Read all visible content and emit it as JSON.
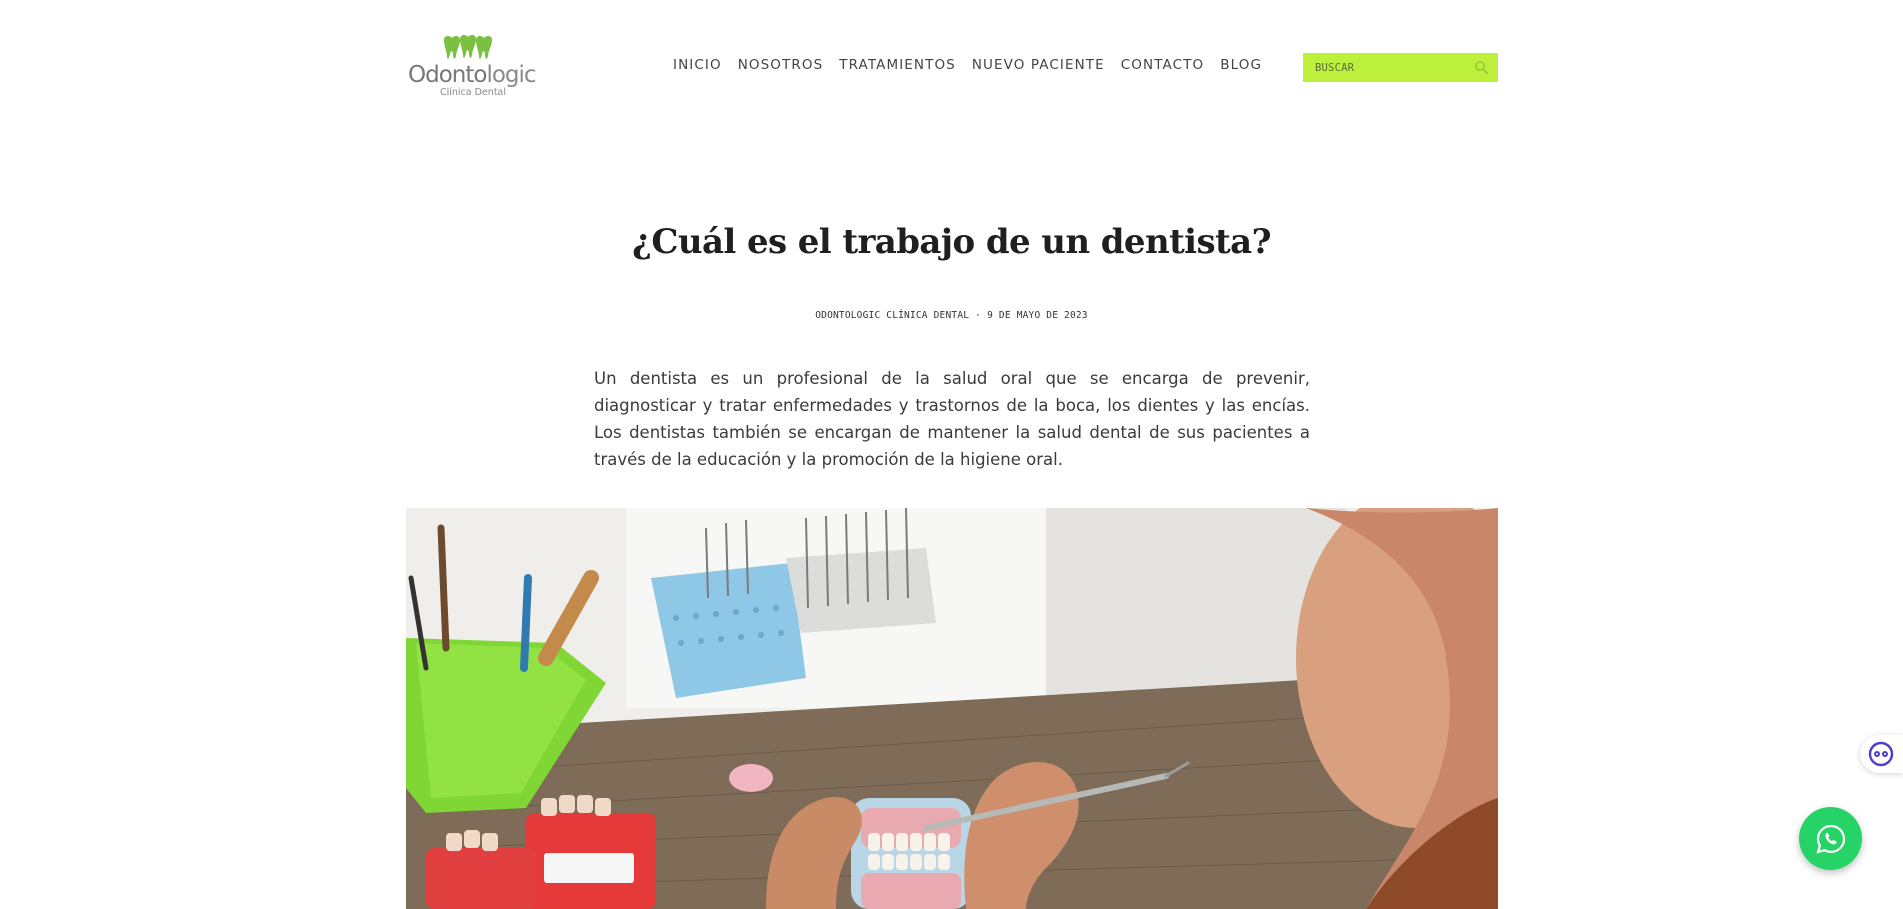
{
  "brand": {
    "name_part1": "Odonto",
    "name_part2": "logic",
    "tagline": "Clínica Dental",
    "accent_color": "#bdf03a",
    "logo_green": "#7ac142"
  },
  "nav": {
    "items": [
      "INICIO",
      "NOSOTROS",
      "TRATAMIENTOS",
      "NUEVO PACIENTE",
      "CONTACTO",
      "BLOG"
    ]
  },
  "search": {
    "placeholder": "BUSCAR",
    "icon": "search-icon"
  },
  "article": {
    "title": "¿Cuál es el trabajo de un dentista?",
    "author": "ODONTOLOGIC CLÍNICA DENTAL",
    "separator": "·",
    "date": "9 DE MAYO DE 2023",
    "intro": "Un dentista es un profesional de la salud oral que se encarga de prevenir, diagnosticar y tratar enfermedades y trastornos de la boca, los dientes y las encías. Los dentistas también se encargan de mantener la salud dental de sus pacientes a través de la educación y la promoción de la higiene oral."
  },
  "widgets": {
    "accessibility_icon": "accessibility-icon",
    "whatsapp_icon": "whatsapp-icon",
    "whatsapp_color": "#25d366"
  }
}
